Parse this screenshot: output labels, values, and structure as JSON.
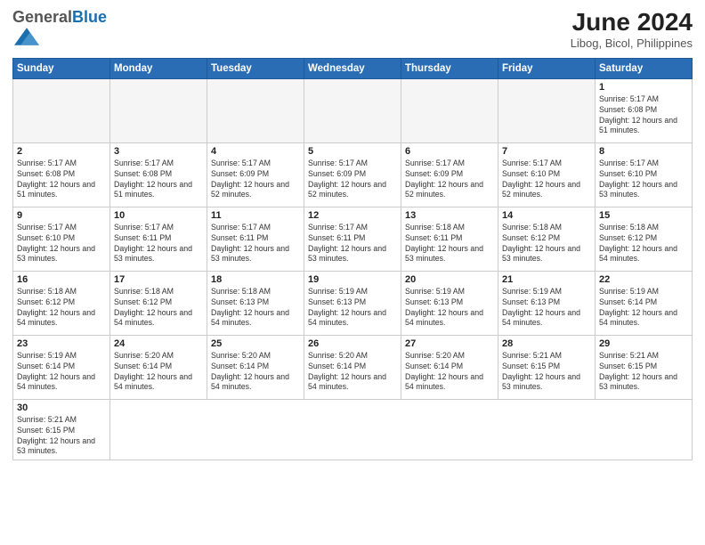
{
  "header": {
    "logo_general": "General",
    "logo_blue": "Blue",
    "title": "June 2024",
    "subtitle": "Libog, Bicol, Philippines"
  },
  "weekdays": [
    "Sunday",
    "Monday",
    "Tuesday",
    "Wednesday",
    "Thursday",
    "Friday",
    "Saturday"
  ],
  "days": [
    {
      "date": "",
      "info": ""
    },
    {
      "date": "",
      "info": ""
    },
    {
      "date": "",
      "info": ""
    },
    {
      "date": "",
      "info": ""
    },
    {
      "date": "",
      "info": ""
    },
    {
      "date": "",
      "info": ""
    },
    {
      "date": "1",
      "info": "Sunrise: 5:17 AM\nSunset: 6:08 PM\nDaylight: 12 hours and 51 minutes."
    },
    {
      "date": "2",
      "info": "Sunrise: 5:17 AM\nSunset: 6:08 PM\nDaylight: 12 hours and 51 minutes."
    },
    {
      "date": "3",
      "info": "Sunrise: 5:17 AM\nSunset: 6:08 PM\nDaylight: 12 hours and 51 minutes."
    },
    {
      "date": "4",
      "info": "Sunrise: 5:17 AM\nSunset: 6:09 PM\nDaylight: 12 hours and 52 minutes."
    },
    {
      "date": "5",
      "info": "Sunrise: 5:17 AM\nSunset: 6:09 PM\nDaylight: 12 hours and 52 minutes."
    },
    {
      "date": "6",
      "info": "Sunrise: 5:17 AM\nSunset: 6:09 PM\nDaylight: 12 hours and 52 minutes."
    },
    {
      "date": "7",
      "info": "Sunrise: 5:17 AM\nSunset: 6:10 PM\nDaylight: 12 hours and 52 minutes."
    },
    {
      "date": "8",
      "info": "Sunrise: 5:17 AM\nSunset: 6:10 PM\nDaylight: 12 hours and 53 minutes."
    },
    {
      "date": "9",
      "info": "Sunrise: 5:17 AM\nSunset: 6:10 PM\nDaylight: 12 hours and 53 minutes."
    },
    {
      "date": "10",
      "info": "Sunrise: 5:17 AM\nSunset: 6:11 PM\nDaylight: 12 hours and 53 minutes."
    },
    {
      "date": "11",
      "info": "Sunrise: 5:17 AM\nSunset: 6:11 PM\nDaylight: 12 hours and 53 minutes."
    },
    {
      "date": "12",
      "info": "Sunrise: 5:17 AM\nSunset: 6:11 PM\nDaylight: 12 hours and 53 minutes."
    },
    {
      "date": "13",
      "info": "Sunrise: 5:18 AM\nSunset: 6:11 PM\nDaylight: 12 hours and 53 minutes."
    },
    {
      "date": "14",
      "info": "Sunrise: 5:18 AM\nSunset: 6:12 PM\nDaylight: 12 hours and 53 minutes."
    },
    {
      "date": "15",
      "info": "Sunrise: 5:18 AM\nSunset: 6:12 PM\nDaylight: 12 hours and 54 minutes."
    },
    {
      "date": "16",
      "info": "Sunrise: 5:18 AM\nSunset: 6:12 PM\nDaylight: 12 hours and 54 minutes."
    },
    {
      "date": "17",
      "info": "Sunrise: 5:18 AM\nSunset: 6:12 PM\nDaylight: 12 hours and 54 minutes."
    },
    {
      "date": "18",
      "info": "Sunrise: 5:18 AM\nSunset: 6:13 PM\nDaylight: 12 hours and 54 minutes."
    },
    {
      "date": "19",
      "info": "Sunrise: 5:19 AM\nSunset: 6:13 PM\nDaylight: 12 hours and 54 minutes."
    },
    {
      "date": "20",
      "info": "Sunrise: 5:19 AM\nSunset: 6:13 PM\nDaylight: 12 hours and 54 minutes."
    },
    {
      "date": "21",
      "info": "Sunrise: 5:19 AM\nSunset: 6:13 PM\nDaylight: 12 hours and 54 minutes."
    },
    {
      "date": "22",
      "info": "Sunrise: 5:19 AM\nSunset: 6:14 PM\nDaylight: 12 hours and 54 minutes."
    },
    {
      "date": "23",
      "info": "Sunrise: 5:19 AM\nSunset: 6:14 PM\nDaylight: 12 hours and 54 minutes."
    },
    {
      "date": "24",
      "info": "Sunrise: 5:20 AM\nSunset: 6:14 PM\nDaylight: 12 hours and 54 minutes."
    },
    {
      "date": "25",
      "info": "Sunrise: 5:20 AM\nSunset: 6:14 PM\nDaylight: 12 hours and 54 minutes."
    },
    {
      "date": "26",
      "info": "Sunrise: 5:20 AM\nSunset: 6:14 PM\nDaylight: 12 hours and 54 minutes."
    },
    {
      "date": "27",
      "info": "Sunrise: 5:20 AM\nSunset: 6:14 PM\nDaylight: 12 hours and 54 minutes."
    },
    {
      "date": "28",
      "info": "Sunrise: 5:21 AM\nSunset: 6:15 PM\nDaylight: 12 hours and 53 minutes."
    },
    {
      "date": "29",
      "info": "Sunrise: 5:21 AM\nSunset: 6:15 PM\nDaylight: 12 hours and 53 minutes."
    },
    {
      "date": "30",
      "info": "Sunrise: 5:21 AM\nSunset: 6:15 PM\nDaylight: 12 hours and 53 minutes."
    }
  ]
}
